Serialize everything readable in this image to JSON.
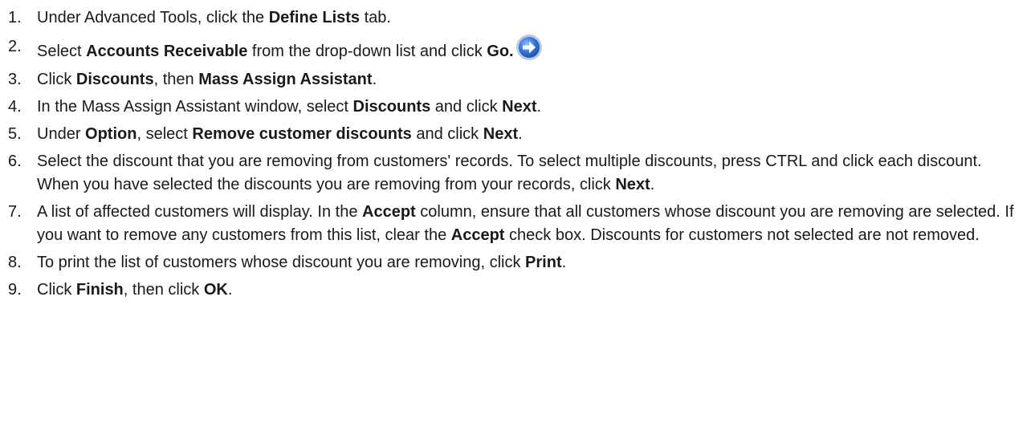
{
  "steps": [
    {
      "number": "1.",
      "parts": [
        {
          "text": "Under Advanced Tools, click the ",
          "bold": false
        },
        {
          "text": "Define Lists",
          "bold": true
        },
        {
          "text": " tab.",
          "bold": false
        }
      ]
    },
    {
      "number": "2.",
      "parts": [
        {
          "text": "Select ",
          "bold": false
        },
        {
          "text": "Accounts Receivable",
          "bold": true
        },
        {
          "text": " from the drop-down list and click ",
          "bold": false
        },
        {
          "text": "Go.",
          "bold": true
        }
      ],
      "icon": "go-arrow-icon"
    },
    {
      "number": "3.",
      "parts": [
        {
          "text": "Click ",
          "bold": false
        },
        {
          "text": "Discounts",
          "bold": true
        },
        {
          "text": ", then ",
          "bold": false
        },
        {
          "text": "Mass Assign Assistant",
          "bold": true
        },
        {
          "text": ".",
          "bold": false
        }
      ]
    },
    {
      "number": "4.",
      "parts": [
        {
          "text": "In the Mass Assign Assistant window, select ",
          "bold": false
        },
        {
          "text": "Discounts",
          "bold": true
        },
        {
          "text": " and click ",
          "bold": false
        },
        {
          "text": "Next",
          "bold": true
        },
        {
          "text": ".",
          "bold": false
        }
      ]
    },
    {
      "number": "5.",
      "parts": [
        {
          "text": "Under ",
          "bold": false
        },
        {
          "text": "Option",
          "bold": true
        },
        {
          "text": ", select ",
          "bold": false
        },
        {
          "text": "Remove customer discounts",
          "bold": true
        },
        {
          "text": " and click ",
          "bold": false
        },
        {
          "text": "Next",
          "bold": true
        },
        {
          "text": ".",
          "bold": false
        }
      ]
    },
    {
      "number": "6.",
      "parts": [
        {
          "text": "Select the discount that you are removing from customers' records. To select multiple discounts, press CTRL and click each discount. When you have selected the discounts you are removing from your records, click ",
          "bold": false
        },
        {
          "text": "Next",
          "bold": true
        },
        {
          "text": ".",
          "bold": false
        }
      ]
    },
    {
      "number": "7.",
      "parts": [
        {
          "text": "A list of affected customers will display. In the ",
          "bold": false
        },
        {
          "text": "Accept",
          "bold": true
        },
        {
          "text": " column, ensure that all customers whose discount you are removing are selected. If you want to remove any customers from this list, clear the ",
          "bold": false
        },
        {
          "text": "Accept",
          "bold": true
        },
        {
          "text": " check box. Discounts for customers not selected are not removed.",
          "bold": false
        }
      ]
    },
    {
      "number": "8.",
      "parts": [
        {
          "text": "To print the list of customers whose discount you are removing, click ",
          "bold": false
        },
        {
          "text": "Print",
          "bold": true
        },
        {
          "text": ".",
          "bold": false
        }
      ]
    },
    {
      "number": "9.",
      "parts": [
        {
          "text": "Click ",
          "bold": false
        },
        {
          "text": "Finish",
          "bold": true
        },
        {
          "text": ", then click ",
          "bold": false
        },
        {
          "text": "OK",
          "bold": true
        },
        {
          "text": ".",
          "bold": false
        }
      ]
    }
  ],
  "colors": {
    "text": "#1a1a1a",
    "icon_blue": "#2f6fd0",
    "icon_rim": "#b9c9dd"
  }
}
